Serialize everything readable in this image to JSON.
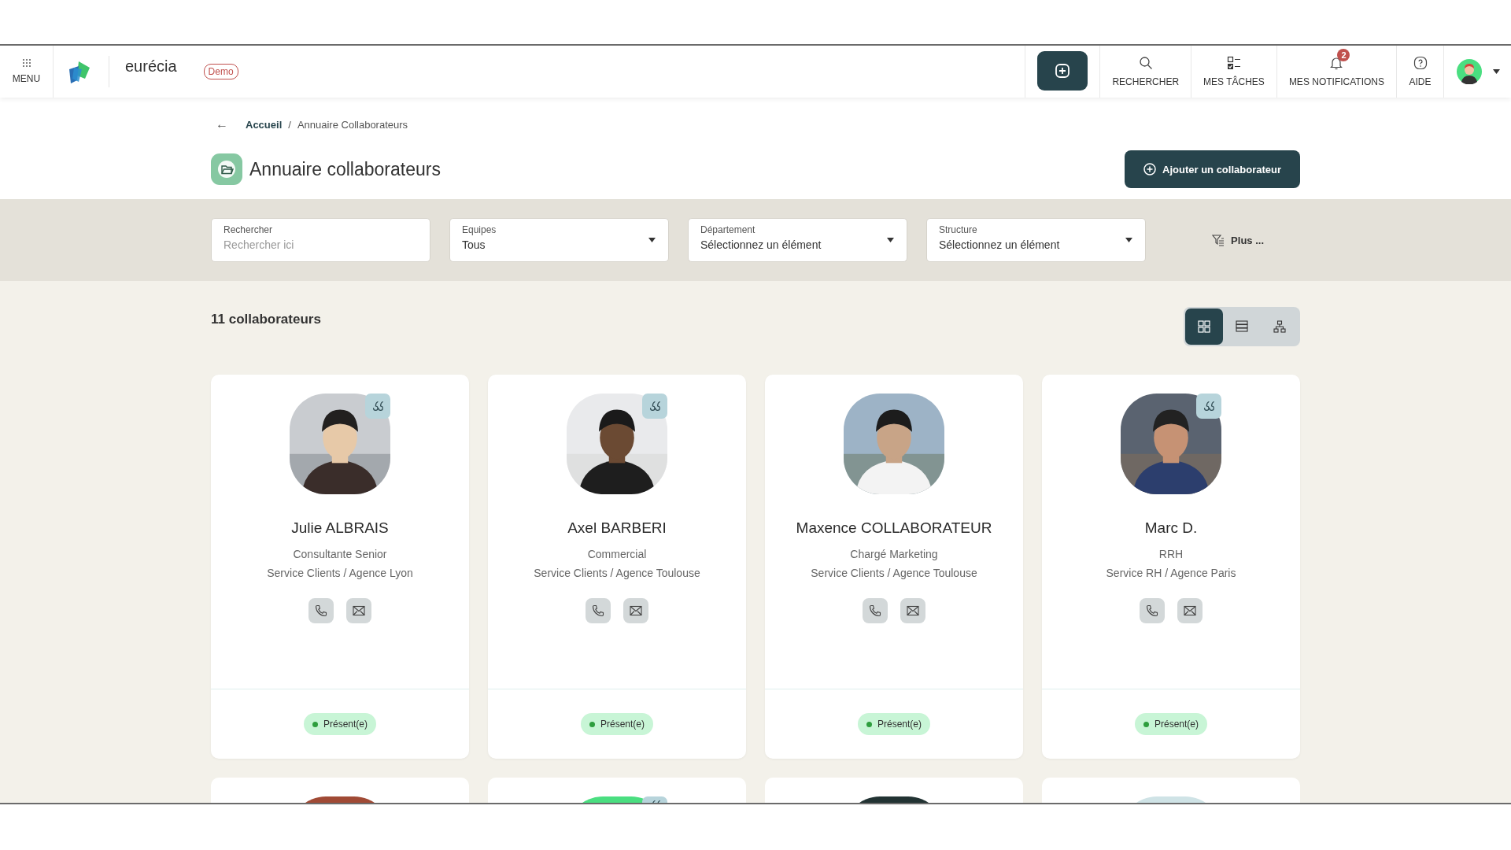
{
  "header": {
    "menu_label": "MENU",
    "brand": "eurécia",
    "badge": "Demo",
    "nav": [
      {
        "kind": "search",
        "label": "RECHERCHER"
      },
      {
        "kind": "tasks",
        "label": "MES TÂCHES"
      },
      {
        "kind": "notifications",
        "label": "MES NOTIFICATIONS",
        "count": "2"
      },
      {
        "kind": "help",
        "label": "AIDE"
      }
    ]
  },
  "breadcrumb": {
    "back": "←",
    "items": [
      {
        "label": "Accueil",
        "link": true
      },
      {
        "label": "Annuaire Collaborateurs",
        "link": false
      }
    ],
    "separator": "/"
  },
  "title": "Annuaire collaborateurs",
  "add_button": "Ajouter un collaborateur",
  "filters": [
    {
      "kind": "text",
      "label": "Rechercher",
      "placeholder": "Rechercher ici"
    },
    {
      "kind": "select",
      "label": "Equipes",
      "value": "Tous"
    },
    {
      "kind": "select",
      "label": "Département",
      "value": "Sélectionnez un élément"
    },
    {
      "kind": "select",
      "label": "Structure",
      "value": "Sélectionnez un élément"
    }
  ],
  "more_filters": "Plus ...",
  "count": "11 collaborateurs",
  "views": [
    {
      "kind": "grid",
      "selected": true
    },
    {
      "kind": "list",
      "selected": false
    },
    {
      "kind": "tree",
      "selected": false
    }
  ],
  "cards": [
    {
      "name": "Julie ALBRAIS",
      "role": "Consultante Senior",
      "unit": "Service Clients / Agence Lyon",
      "quote": true,
      "status": "Présent(e)"
    },
    {
      "name": "Axel BARBERI",
      "role": "Commercial",
      "unit": "Service Clients / Agence Toulouse",
      "quote": true,
      "status": "Présent(e)"
    },
    {
      "name": "Maxence COLLABORATEUR",
      "role": "Chargé Marketing",
      "unit": "Service Clients / Agence Toulouse",
      "quote": false,
      "status": "Présent(e)"
    },
    {
      "name": "Marc D.",
      "role": "RRH",
      "unit": "Service RH / Agence Paris",
      "quote": true,
      "status": "Présent(e)"
    }
  ],
  "more_cards": [
    {
      "quote": false
    },
    {
      "quote": true
    },
    {
      "quote": false
    },
    {
      "quote": false
    }
  ]
}
